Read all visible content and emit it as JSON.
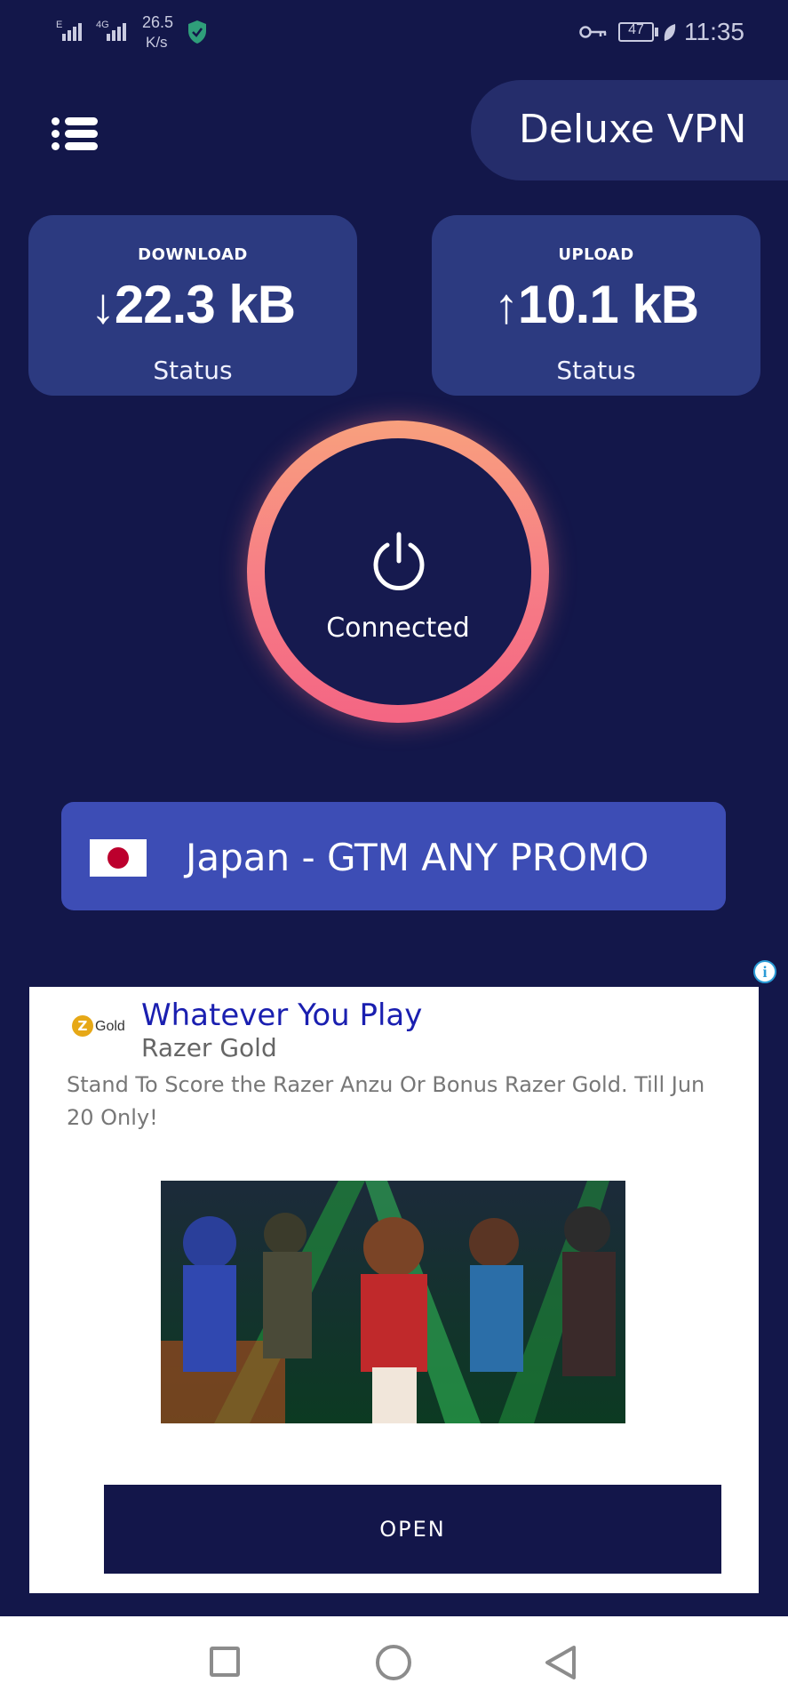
{
  "status_bar": {
    "network_type_1": "E",
    "network_type_2": "4G",
    "speed_value": "26.5",
    "speed_unit": "K/s",
    "battery": "47",
    "time": "11:35",
    "icons": [
      "signal-icon",
      "signal-4g-icon",
      "shield-check-icon",
      "key-icon",
      "battery-icon",
      "leaf-icon"
    ]
  },
  "header": {
    "menu_icon": "list-menu-icon",
    "app_title": "Deluxe VPN"
  },
  "stats": {
    "download": {
      "label": "DOWNLOAD",
      "arrow": "↓",
      "value": "22.3 kB",
      "status": "Status"
    },
    "upload": {
      "label": "UPLOAD",
      "arrow": "↑",
      "value": "10.1 kB",
      "status": "Status"
    }
  },
  "connect": {
    "icon": "power-icon",
    "state_label": "Connected",
    "ring_colors": [
      "#f8a07d",
      "#f46583"
    ]
  },
  "server": {
    "flag": "japan-flag",
    "label": "Japan - GTM ANY PROMO"
  },
  "ad": {
    "info_icon": "info-icon",
    "logo_mark": "Z",
    "logo_text": "Gold",
    "title": "Whatever You Play",
    "advertiser": "Razer Gold",
    "description": "Stand To Score the Razer Anzu Or Bonus Razer Gold. Till Jun 20 Only!",
    "cta": "OPEN"
  },
  "nav": {
    "icons": [
      "recents-square-icon",
      "home-circle-icon",
      "back-triangle-icon"
    ]
  },
  "colors": {
    "background": "#13174a",
    "card": "#2c3a80",
    "title_pill": "#252d6b",
    "server_bar": "#3d4db5",
    "ad_title": "#1a1fb0",
    "cta_button": "#13164a"
  }
}
